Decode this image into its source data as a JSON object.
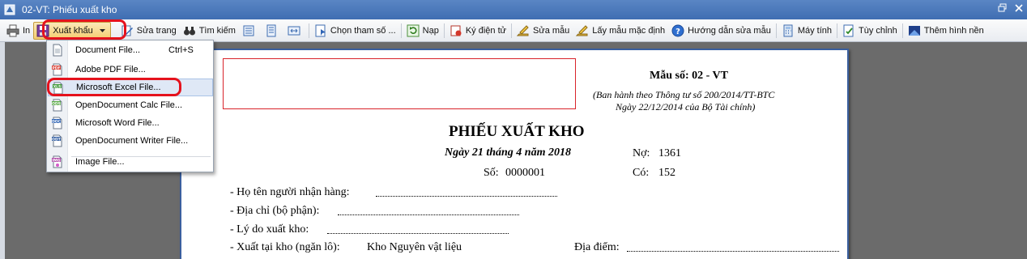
{
  "window": {
    "title": "02-VT: Phiếu xuất kho"
  },
  "toolbar": {
    "print": "In",
    "export": "Xuất khẩu",
    "edit_page": "Sửa trang",
    "search": "Tìm kiếm",
    "choose_params": "Chọn tham số ...",
    "reload": "Nạp",
    "e_sign": "Ký điện tử",
    "edit_template": "Sửa mẫu",
    "default_template": "Lấy mẫu mặc định",
    "guide": "Hướng dẫn sửa mẫu",
    "calculator": "Máy tính",
    "customize": "Tùy chỉnh",
    "background": "Thêm hình nền"
  },
  "export_menu": {
    "items": [
      {
        "label": "Document File...",
        "shortcut": "Ctrl+S",
        "icon": "document-icon"
      },
      {
        "label": "Adobe PDF File...",
        "shortcut": "",
        "icon": "pdf-icon"
      },
      {
        "label": "Microsoft Excel File...",
        "shortcut": "",
        "icon": "xls-icon"
      },
      {
        "label": "OpenDocument Calc File...",
        "shortcut": "",
        "icon": "ods-icon"
      },
      {
        "label": "Microsoft Word File...",
        "shortcut": "",
        "icon": "doc-icon"
      },
      {
        "label": "OpenDocument Writer File...",
        "shortcut": "",
        "icon": "odt-icon"
      },
      {
        "label": "Image File...",
        "shortcut": "",
        "icon": "image-icon"
      }
    ],
    "highlighted_index": 2
  },
  "document": {
    "form_code": "Mẫu số: 02 - VT",
    "issued_line1": "(Ban hành theo Thông tư số 200/2014/TT-BTC",
    "issued_line2": "Ngày 22/12/2014 của Bộ Tài chính)",
    "title": "PHIẾU XUẤT KHO",
    "date": "Ngày 21 tháng 4 năm 2018",
    "debit_label": "Nợ:",
    "debit_value": "1361",
    "number_label": "Số:",
    "number_value": "0000001",
    "credit_label": "Có:",
    "credit_value": "152",
    "fields": {
      "receiver": "- Họ tên người nhận hàng:",
      "address": "- Địa chỉ (bộ phận):",
      "reason": "- Lý do xuất kho:",
      "warehouse_label": "- Xuất tại kho (ngăn lô):",
      "warehouse_value": "Kho Nguyên vật liệu",
      "location_label": "Địa điểm:"
    }
  },
  "colors": {
    "titlebar": "#4a7bbf",
    "highlight_ring": "#e5121d",
    "page_border": "#3a5f9e"
  }
}
